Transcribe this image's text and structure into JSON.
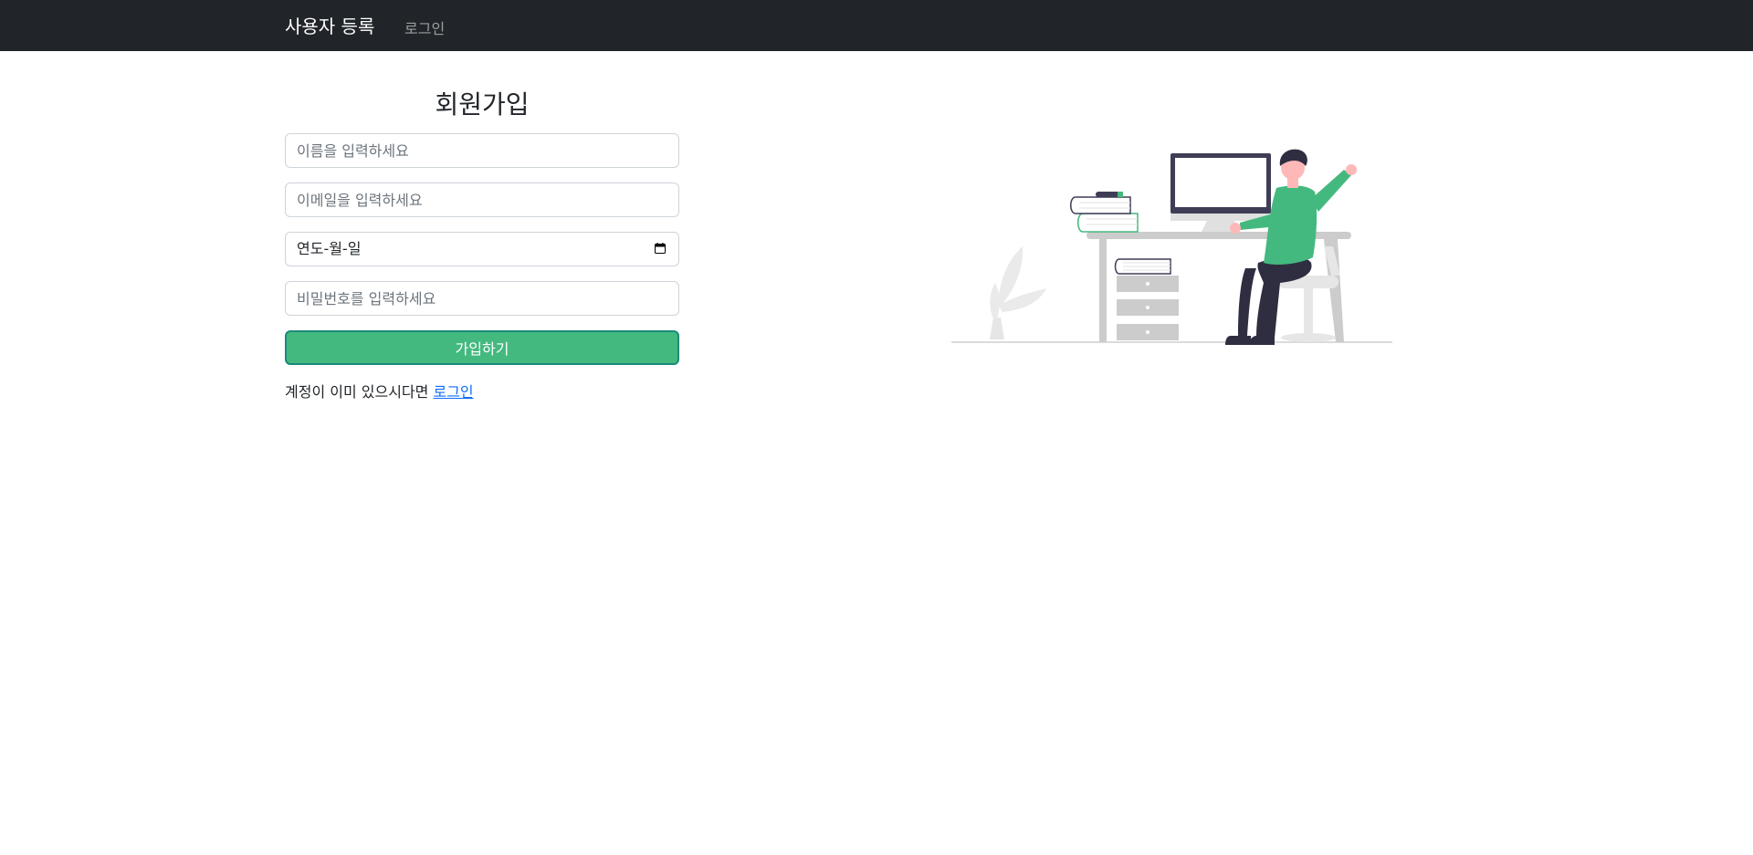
{
  "navbar": {
    "brand": "사용자 등록",
    "login_link": "로그인"
  },
  "form": {
    "title": "회원가입",
    "name_placeholder": "이름을 입력하세요",
    "email_placeholder": "이메일을 입력하세요",
    "date_value": "연도-월-일",
    "password_placeholder": "비밀번호를 입력하세요",
    "submit_label": "가입하기"
  },
  "footer_text": {
    "prompt": "계정이 이미 있으시다면",
    "login_link": "로그인"
  },
  "colors": {
    "navbar_bg": "#212529",
    "accent": "#44b97f",
    "link": "#0d6efd"
  },
  "illustration": {
    "icon": "person-at-desk-illustration"
  }
}
